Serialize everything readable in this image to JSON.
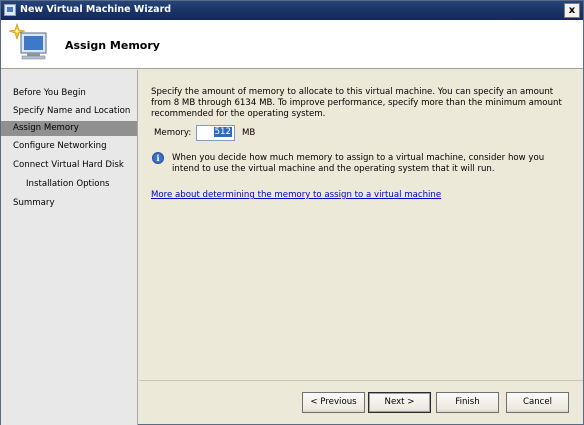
{
  "window": {
    "title": "New Virtual Machine Wizard",
    "close_glyph": "x"
  },
  "header": {
    "title": "Assign Memory",
    "icon": "wizard-computer-sparkle-icon"
  },
  "sidebar": {
    "items": [
      {
        "label": "Before You Begin",
        "indent": false,
        "active": false
      },
      {
        "label": "Specify Name and Location",
        "indent": false,
        "active": false
      },
      {
        "label": "Assign Memory",
        "indent": false,
        "active": true
      },
      {
        "label": "Configure Networking",
        "indent": false,
        "active": false
      },
      {
        "label": "Connect Virtual Hard Disk",
        "indent": false,
        "active": false
      },
      {
        "label": "Installation Options",
        "indent": true,
        "active": false
      },
      {
        "label": "Summary",
        "indent": false,
        "active": false
      }
    ]
  },
  "main": {
    "description": "Specify the amount of memory to allocate to this virtual machine. You can specify an amount from 8 MB through 6134 MB. To improve performance, specify more than the minimum amount recommended for the operating system.",
    "memory_label": "Memory:",
    "memory_value": "512",
    "memory_unit": "MB",
    "info_text": "When you decide how much memory to assign to a virtual machine, consider how you intend to use the virtual machine and the operating system that it will run.",
    "more_link": "More about determining the memory to assign to a virtual machine"
  },
  "buttons": {
    "previous": "< Previous",
    "next": "Next >",
    "finish": "Finish",
    "cancel": "Cancel"
  }
}
